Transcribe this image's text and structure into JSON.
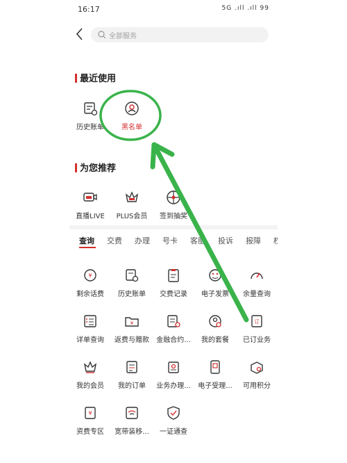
{
  "status_bar": {
    "time": "16:17",
    "indicators": "5G  .ıll  .ıll  99"
  },
  "search": {
    "placeholder": "全部服务"
  },
  "recent": {
    "title": "最近使用",
    "items": [
      {
        "label": "历史账单",
        "icon": "bill-history-icon"
      },
      {
        "label": "黑名单",
        "icon": "blacklist-icon"
      }
    ]
  },
  "recommend": {
    "title": "为您推荐",
    "items": [
      {
        "label": "直播LIVE",
        "icon": "live-icon"
      },
      {
        "label": "PLUS会员",
        "icon": "plus-crown-icon"
      },
      {
        "label": "签到抽奖",
        "icon": "lottery-icon"
      }
    ]
  },
  "tabs": [
    "查询",
    "交费",
    "办理",
    "号卡",
    "客服",
    "投诉",
    "报障",
    "权"
  ],
  "active_tab": 0,
  "grid": {
    "items": [
      {
        "label": "剩余话费",
        "icon": "balance-icon"
      },
      {
        "label": "历史账单",
        "icon": "bill-history-icon"
      },
      {
        "label": "交费记录",
        "icon": "payment-record-icon"
      },
      {
        "label": "电子发票",
        "icon": "e-invoice-icon"
      },
      {
        "label": "余量查询",
        "icon": "usage-gauge-icon"
      },
      {
        "label": "详单查询",
        "icon": "detail-list-icon"
      },
      {
        "label": "返费与赠款",
        "icon": "refund-folder-icon"
      },
      {
        "label": "金融合约...",
        "icon": "finance-contract-icon"
      },
      {
        "label": "我的套餐",
        "icon": "my-plan-icon"
      },
      {
        "label": "已订业务",
        "icon": "subscribed-icon"
      },
      {
        "label": "我的会员",
        "icon": "member-crown-icon"
      },
      {
        "label": "我的订单",
        "icon": "my-order-icon"
      },
      {
        "label": "业务办理...",
        "icon": "business-handle-icon"
      },
      {
        "label": "电子受理...",
        "icon": "e-acceptance-icon"
      },
      {
        "label": "可用积分",
        "icon": "points-icon"
      },
      {
        "label": "资费专区",
        "icon": "tariff-icon"
      },
      {
        "label": "宽带装移...",
        "icon": "broadband-icon"
      },
      {
        "label": "一证通查",
        "icon": "id-check-icon"
      }
    ]
  },
  "colors": {
    "accent": "#d32f2f",
    "annotation": "#3ab34a",
    "icon_stroke": "#333333"
  }
}
